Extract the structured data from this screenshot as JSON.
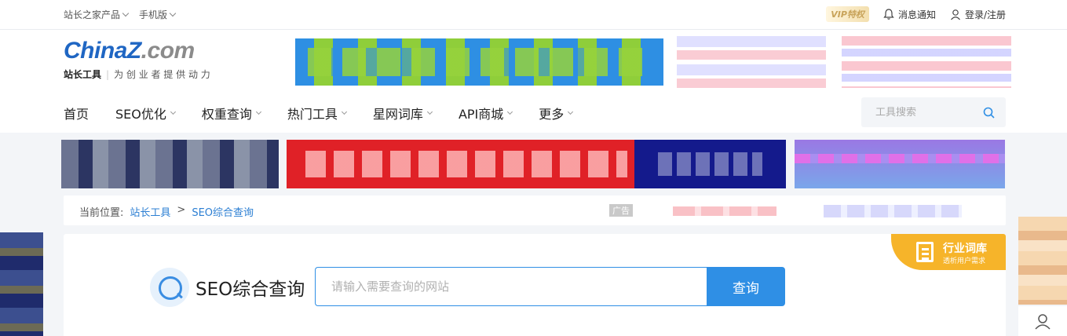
{
  "topbar": {
    "products_label": "站长之家产品",
    "mobile_label": "手机版",
    "vip_label": "VIP特权",
    "notify_label": "消息通知",
    "login_label": "登录/注册"
  },
  "logo": {
    "brand_main": "ChinaZ",
    "brand_suffix": ".com",
    "slogan_bold": "站长工具",
    "slogan": "为 创 业 者 提 供 动 力"
  },
  "nav": {
    "items": [
      {
        "label": "首页"
      },
      {
        "label": "SEO优化"
      },
      {
        "label": "权重查询"
      },
      {
        "label": "热门工具"
      },
      {
        "label": "星网词库"
      },
      {
        "label": "API商城"
      },
      {
        "label": "更多"
      }
    ]
  },
  "search": {
    "placeholder": "工具搜索",
    "icon": "search-icon"
  },
  "breadcrumb": {
    "prefix": "当前位置:",
    "items": [
      "站长工具",
      ">",
      "SEO综合查询"
    ],
    "ad_tag": "广告"
  },
  "main": {
    "tool_title": "SEO综合查询",
    "query_placeholder": "请输入需要查询的网站",
    "query_button": "查询",
    "badge_title": "行业词库",
    "badge_subtitle": "透析用户需求"
  },
  "colors": {
    "accent": "#2f8fe5",
    "brand_blue": "#1f66c3",
    "badge": "#f6b42a"
  }
}
